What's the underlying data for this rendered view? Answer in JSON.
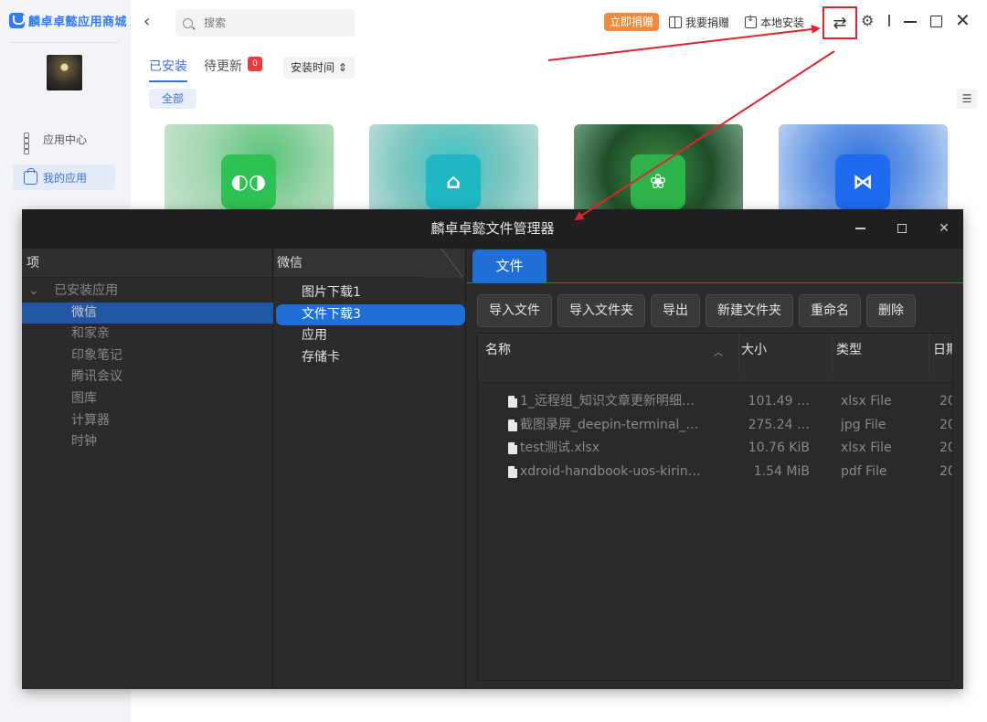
{
  "store": {
    "app_name": "麟卓卓懿应用商城",
    "nav": {
      "app_center": "应用中心",
      "my_apps": "我的应用"
    },
    "search": {
      "placeholder": "搜索",
      "value": ""
    },
    "header": {
      "donate_now": "立即捐赠",
      "i_donate": "我要捐赠",
      "local_install": "本地安装"
    },
    "tabs": {
      "installed": "已安装",
      "pending_update": "待更新",
      "pending_count": "0"
    },
    "sort": {
      "selected": "安装时间"
    },
    "filter": {
      "all": "全部"
    },
    "app_cards": [
      "wechat",
      "family",
      "evernote",
      "meeting"
    ]
  },
  "file_manager": {
    "title": "麟卓卓懿文件管理器",
    "left_pane": {
      "header": "项",
      "root": "已安装应用",
      "items": [
        "微信",
        "和家亲",
        "印象笔记",
        "腾讯会议",
        "图库",
        "计算器",
        "时钟"
      ],
      "selected_index": 0
    },
    "mid_pane": {
      "header": "微信",
      "items": [
        "图片下载1",
        "文件下载3",
        "应用",
        "存储卡"
      ],
      "selected_index": 1
    },
    "right_pane": {
      "tab": "文件",
      "toolbar": [
        "导入文件",
        "导入文件夹",
        "导出",
        "新建文件夹",
        "重命名",
        "删除"
      ],
      "columns": {
        "name": "名称",
        "size": "大小",
        "type": "类型",
        "date": "日期"
      },
      "files": [
        {
          "name": "1_远程组_知识文章更新明细…",
          "size": "101.49 …",
          "type": "xlsx File",
          "date": "20"
        },
        {
          "name": "截图录屏_deepin-terminal_…",
          "size": "275.24 …",
          "type": "jpg File",
          "date": "20"
        },
        {
          "name": "test测试.xlsx",
          "size": "10.76 KiB",
          "type": "xlsx File",
          "date": "20"
        },
        {
          "name": "xdroid-handbook-uos-kirin…",
          "size": "1.54 MiB",
          "type": "pdf File",
          "date": "20"
        }
      ]
    }
  },
  "colors": {
    "accent": "#1f6fd6",
    "store_accent": "#3a6fd8",
    "annotation": "#e0232e",
    "donate": "#f08a3c"
  }
}
